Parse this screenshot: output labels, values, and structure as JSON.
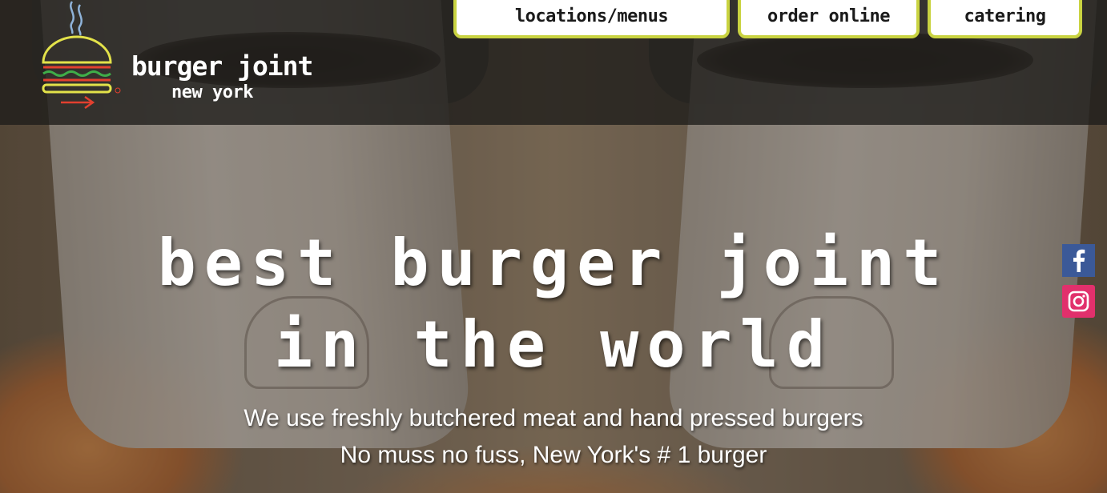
{
  "header": {
    "brand_name": "burger joint",
    "brand_sub": "new york",
    "colors": {
      "accent": "#c9d341",
      "header_bg": "#1e1c1a",
      "logo_bun": "#e3e24a",
      "logo_lettuce": "#3fae49",
      "logo_patty": "#e2402f",
      "logo_steam": "#8fb3d9"
    },
    "nav": [
      {
        "label": "locations/menus"
      },
      {
        "label": "order online"
      },
      {
        "label": "catering"
      }
    ]
  },
  "hero": {
    "headline_line1": "best burger joint",
    "headline_line2": "in the world",
    "tagline_line1": "We use freshly butchered meat and hand pressed burgers",
    "tagline_line2": "No muss no fuss, New York's # 1 burger"
  },
  "social": [
    {
      "icon": "facebook-icon",
      "color": "#3b5998"
    },
    {
      "icon": "instagram-icon",
      "color": "#e1306c"
    }
  ]
}
